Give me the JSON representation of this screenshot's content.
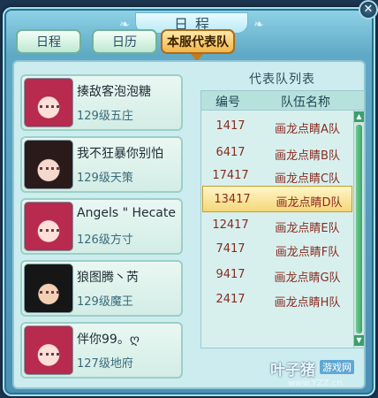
{
  "window": {
    "title": "日程",
    "close_glyph": "✕"
  },
  "tabs": [
    {
      "label": "日程",
      "active": false
    },
    {
      "label": "日历",
      "active": false
    },
    {
      "label": "本服代表队",
      "active": true
    }
  ],
  "players": [
    {
      "name": "揍敌客泡泡糖",
      "level": "129级五庄",
      "avatar": "red-hair-girl"
    },
    {
      "name": "我不狂暴你别怕",
      "level": "129级天策",
      "avatar": "demon-horn-girl"
    },
    {
      "name": "Angels \" Hecate",
      "level": "126级方寸",
      "avatar": "red-hair-girl"
    },
    {
      "name": "狼图腾丶芮",
      "level": "129级魔王",
      "avatar": "dark-hair-boy"
    },
    {
      "name": "伴你99。ღ",
      "level": "127级地府",
      "avatar": "red-hair-girl"
    }
  ],
  "team_list": {
    "title": "代表队列表",
    "headers": {
      "code": "编号",
      "team": "队伍名称"
    },
    "rows": [
      {
        "code": "1417",
        "team": "画龙点睛A队",
        "selected": false
      },
      {
        "code": "6417",
        "team": "画龙点睛B队",
        "selected": false
      },
      {
        "code": "17417",
        "team": "画龙点睛C队",
        "selected": false
      },
      {
        "code": "13417",
        "team": "画龙点睛D队",
        "selected": true
      },
      {
        "code": "12417",
        "team": "画龙点睛E队",
        "selected": false
      },
      {
        "code": "7417",
        "team": "画龙点睛F队",
        "selected": false
      },
      {
        "code": "9417",
        "team": "画龙点睛G队",
        "selected": false
      },
      {
        "code": "2417",
        "team": "画龙点睛H队",
        "selected": false
      }
    ],
    "scroll_up": "▲",
    "scroll_down": "▼"
  },
  "watermark": {
    "main": "叶子猪",
    "sub": "游戏网",
    "url": "www.YZZ.cn"
  },
  "colors": {
    "active_tab": "#f2b54a",
    "selected_row": "#f4d77a",
    "team_text": "#8a2a20"
  }
}
